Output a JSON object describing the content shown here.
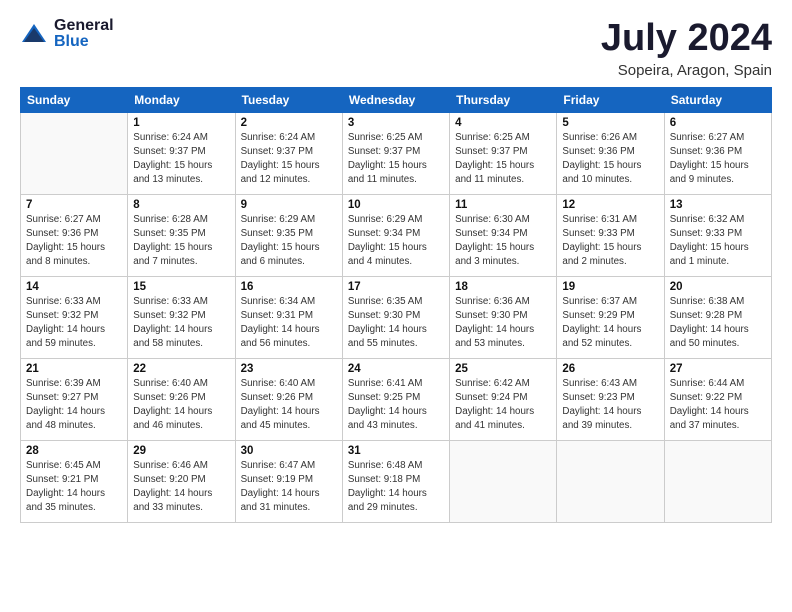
{
  "logo": {
    "general": "General",
    "blue": "Blue"
  },
  "title": "July 2024",
  "subtitle": "Sopeira, Aragon, Spain",
  "days_header": [
    "Sunday",
    "Monday",
    "Tuesday",
    "Wednesday",
    "Thursday",
    "Friday",
    "Saturday"
  ],
  "weeks": [
    [
      {
        "num": "",
        "info": ""
      },
      {
        "num": "1",
        "info": "Sunrise: 6:24 AM\nSunset: 9:37 PM\nDaylight: 15 hours\nand 13 minutes."
      },
      {
        "num": "2",
        "info": "Sunrise: 6:24 AM\nSunset: 9:37 PM\nDaylight: 15 hours\nand 12 minutes."
      },
      {
        "num": "3",
        "info": "Sunrise: 6:25 AM\nSunset: 9:37 PM\nDaylight: 15 hours\nand 11 minutes."
      },
      {
        "num": "4",
        "info": "Sunrise: 6:25 AM\nSunset: 9:37 PM\nDaylight: 15 hours\nand 11 minutes."
      },
      {
        "num": "5",
        "info": "Sunrise: 6:26 AM\nSunset: 9:36 PM\nDaylight: 15 hours\nand 10 minutes."
      },
      {
        "num": "6",
        "info": "Sunrise: 6:27 AM\nSunset: 9:36 PM\nDaylight: 15 hours\nand 9 minutes."
      }
    ],
    [
      {
        "num": "7",
        "info": "Sunrise: 6:27 AM\nSunset: 9:36 PM\nDaylight: 15 hours\nand 8 minutes."
      },
      {
        "num": "8",
        "info": "Sunrise: 6:28 AM\nSunset: 9:35 PM\nDaylight: 15 hours\nand 7 minutes."
      },
      {
        "num": "9",
        "info": "Sunrise: 6:29 AM\nSunset: 9:35 PM\nDaylight: 15 hours\nand 6 minutes."
      },
      {
        "num": "10",
        "info": "Sunrise: 6:29 AM\nSunset: 9:34 PM\nDaylight: 15 hours\nand 4 minutes."
      },
      {
        "num": "11",
        "info": "Sunrise: 6:30 AM\nSunset: 9:34 PM\nDaylight: 15 hours\nand 3 minutes."
      },
      {
        "num": "12",
        "info": "Sunrise: 6:31 AM\nSunset: 9:33 PM\nDaylight: 15 hours\nand 2 minutes."
      },
      {
        "num": "13",
        "info": "Sunrise: 6:32 AM\nSunset: 9:33 PM\nDaylight: 15 hours\nand 1 minute."
      }
    ],
    [
      {
        "num": "14",
        "info": "Sunrise: 6:33 AM\nSunset: 9:32 PM\nDaylight: 14 hours\nand 59 minutes."
      },
      {
        "num": "15",
        "info": "Sunrise: 6:33 AM\nSunset: 9:32 PM\nDaylight: 14 hours\nand 58 minutes."
      },
      {
        "num": "16",
        "info": "Sunrise: 6:34 AM\nSunset: 9:31 PM\nDaylight: 14 hours\nand 56 minutes."
      },
      {
        "num": "17",
        "info": "Sunrise: 6:35 AM\nSunset: 9:30 PM\nDaylight: 14 hours\nand 55 minutes."
      },
      {
        "num": "18",
        "info": "Sunrise: 6:36 AM\nSunset: 9:30 PM\nDaylight: 14 hours\nand 53 minutes."
      },
      {
        "num": "19",
        "info": "Sunrise: 6:37 AM\nSunset: 9:29 PM\nDaylight: 14 hours\nand 52 minutes."
      },
      {
        "num": "20",
        "info": "Sunrise: 6:38 AM\nSunset: 9:28 PM\nDaylight: 14 hours\nand 50 minutes."
      }
    ],
    [
      {
        "num": "21",
        "info": "Sunrise: 6:39 AM\nSunset: 9:27 PM\nDaylight: 14 hours\nand 48 minutes."
      },
      {
        "num": "22",
        "info": "Sunrise: 6:40 AM\nSunset: 9:26 PM\nDaylight: 14 hours\nand 46 minutes."
      },
      {
        "num": "23",
        "info": "Sunrise: 6:40 AM\nSunset: 9:26 PM\nDaylight: 14 hours\nand 45 minutes."
      },
      {
        "num": "24",
        "info": "Sunrise: 6:41 AM\nSunset: 9:25 PM\nDaylight: 14 hours\nand 43 minutes."
      },
      {
        "num": "25",
        "info": "Sunrise: 6:42 AM\nSunset: 9:24 PM\nDaylight: 14 hours\nand 41 minutes."
      },
      {
        "num": "26",
        "info": "Sunrise: 6:43 AM\nSunset: 9:23 PM\nDaylight: 14 hours\nand 39 minutes."
      },
      {
        "num": "27",
        "info": "Sunrise: 6:44 AM\nSunset: 9:22 PM\nDaylight: 14 hours\nand 37 minutes."
      }
    ],
    [
      {
        "num": "28",
        "info": "Sunrise: 6:45 AM\nSunset: 9:21 PM\nDaylight: 14 hours\nand 35 minutes."
      },
      {
        "num": "29",
        "info": "Sunrise: 6:46 AM\nSunset: 9:20 PM\nDaylight: 14 hours\nand 33 minutes."
      },
      {
        "num": "30",
        "info": "Sunrise: 6:47 AM\nSunset: 9:19 PM\nDaylight: 14 hours\nand 31 minutes."
      },
      {
        "num": "31",
        "info": "Sunrise: 6:48 AM\nSunset: 9:18 PM\nDaylight: 14 hours\nand 29 minutes."
      },
      {
        "num": "",
        "info": ""
      },
      {
        "num": "",
        "info": ""
      },
      {
        "num": "",
        "info": ""
      }
    ]
  ]
}
